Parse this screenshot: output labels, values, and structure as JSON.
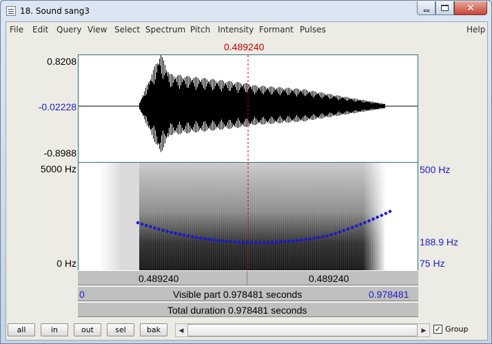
{
  "window": {
    "title": "18. Sound sang3"
  },
  "menu": [
    "File",
    "Edit",
    "Query",
    "View",
    "Select",
    "Spectrum",
    "Pitch",
    "Intensity",
    "Formant",
    "Pulses"
  ],
  "help": "Help",
  "cursor": {
    "time": "0.489240"
  },
  "waveform": {
    "ymax": "0.8208",
    "ymid": "-0.02228",
    "ymin": "-0.8988"
  },
  "spectrogram": {
    "fmax": "5000 Hz",
    "fmin": "0 Hz"
  },
  "pitch": {
    "max": "500 Hz",
    "current": "188.9 Hz",
    "min": "75 Hz"
  },
  "time_bar": {
    "left": "0.489240",
    "right": "0.489240"
  },
  "visible_bar": {
    "start": "0",
    "label": "Visible part 0.978481 seconds",
    "end": "0.978481"
  },
  "total_bar": {
    "label": "Total duration 0.978481 seconds"
  },
  "buttons": {
    "all": "all",
    "in": "in",
    "out": "out",
    "sel": "sel",
    "bak": "bak"
  },
  "group": {
    "label": "Group",
    "checked": "✓"
  },
  "colors": {
    "cursor": "#d00000",
    "pitch": "#1a1acc"
  }
}
